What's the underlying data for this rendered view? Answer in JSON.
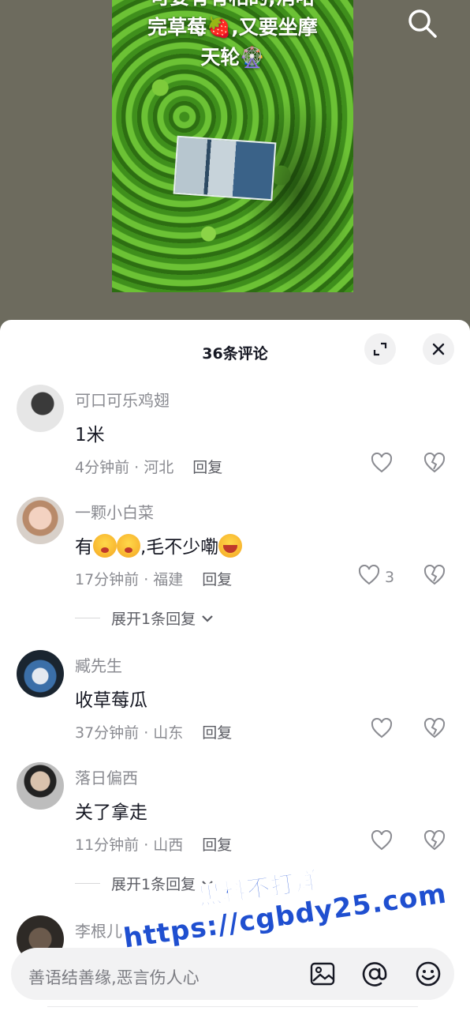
{
  "video": {
    "caption_lines": [
      "可要有有相的,消哈",
      "完草莓🍓,又要坐摩",
      "天轮🎡"
    ]
  },
  "sheet": {
    "title": "36条评论"
  },
  "comments": [
    {
      "username": "可口可乐鸡翅",
      "text": "1米",
      "time_location": "4分钟前 · 河北",
      "reply_label": "回复",
      "like_count": ""
    },
    {
      "username": "一颗小白菜",
      "text_prefix": "有",
      "text_suffix": ",毛不少嘞",
      "time_location": "17分钟前 · 福建",
      "reply_label": "回复",
      "like_count": "3",
      "expand_label": "展开1条回复"
    },
    {
      "username": "臧先生",
      "text": "收草莓瓜",
      "time_location": "37分钟前 · 山东",
      "reply_label": "回复",
      "like_count": ""
    },
    {
      "username": "落日偏西",
      "text": "关了拿走",
      "time_location": "11分钟前 · 山西",
      "reply_label": "回复",
      "like_count": "",
      "expand_label": "展开1条回复"
    },
    {
      "username": "李根儿"
    }
  ],
  "watermark": {
    "line1": "黑料不打烊",
    "line2": "https://cgbdy25.com"
  },
  "input": {
    "placeholder": "善语结善缘,恶言伤人心"
  },
  "icons": {
    "search": "search-icon",
    "expand": "expand-icon",
    "close": "close-icon",
    "like": "heart-icon",
    "dislike": "broken-heart-icon",
    "image": "image-icon",
    "mention": "at-icon",
    "emoji": "emoji-icon"
  }
}
